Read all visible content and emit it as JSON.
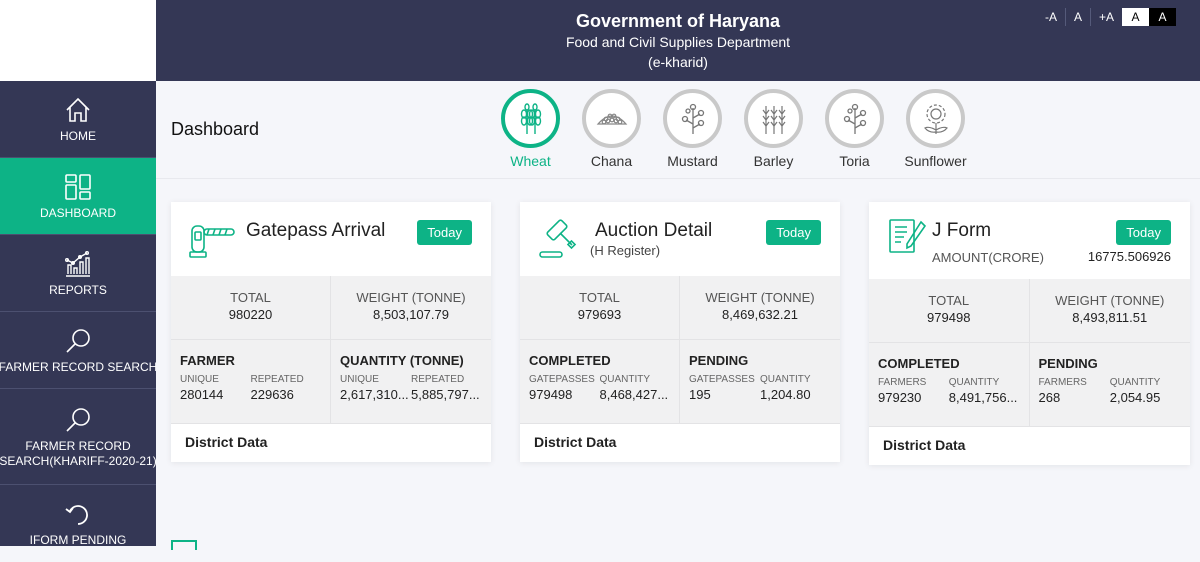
{
  "header": {
    "title": "Government of Haryana",
    "subtitle": "Food and Civil Supplies Department",
    "app": "(e-kharid)"
  },
  "font_controls": [
    "-A",
    "A",
    "+A",
    "A",
    "A"
  ],
  "sidebar": {
    "items": [
      {
        "label": "HOME",
        "icon": "home-icon"
      },
      {
        "label": "DASHBOARD",
        "icon": "dashboard-icon",
        "active": true
      },
      {
        "label": "REPORTS",
        "icon": "reports-icon"
      },
      {
        "label": "FARMER RECORD SEARCH",
        "icon": "search-icon"
      },
      {
        "label1": "FARMER RECORD",
        "label2": "SEARCH(KHARIFF-2020-21)",
        "icon": "search-icon"
      },
      {
        "label": "IFORM PENDING",
        "icon": "refresh-icon"
      }
    ]
  },
  "page_title": "Dashboard",
  "crops": [
    {
      "name": "Wheat",
      "active": true
    },
    {
      "name": "Chana"
    },
    {
      "name": "Mustard"
    },
    {
      "name": "Barley"
    },
    {
      "name": "Toria"
    },
    {
      "name": "Sunflower"
    }
  ],
  "colors": {
    "accent": "#0db386",
    "navy": "#343755"
  },
  "cards": {
    "gatepass": {
      "title": "Gatepass Arrival",
      "today": "Today",
      "total_label": "TOTAL",
      "total": "980220",
      "weight_label": "WEIGHT (TONNE)",
      "weight": "8,503,107.79",
      "left": {
        "heading": "FARMER",
        "k1": "UNIQUE",
        "v1": "280144",
        "k2": "REPEATED",
        "v2": "229636"
      },
      "right": {
        "heading": "QUANTITY (TONNE)",
        "k1": "UNIQUE",
        "v1": "2,617,310...",
        "k2": "REPEATED",
        "v2": "5,885,797..."
      },
      "district": "District Data"
    },
    "auction": {
      "title": "Auction Detail",
      "subtitle": "(H Register)",
      "today": "Today",
      "total_label": "TOTAL",
      "total": "979693",
      "weight_label": "WEIGHT (TONNE)",
      "weight": "8,469,632.21",
      "left": {
        "heading": "COMPLETED",
        "k1": "GATEPASSES",
        "v1": "979498",
        "k2": "QUANTITY",
        "v2": "8,468,427..."
      },
      "right": {
        "heading": "PENDING",
        "k1": "GATEPASSES",
        "v1": "195",
        "k2": "QUANTITY",
        "v2": "1,204.80"
      },
      "district": "District Data"
    },
    "jform": {
      "title": "J Form",
      "subtitle": "AMOUNT(CRORE)",
      "amount": "16775.506926",
      "today": "Today",
      "total_label": "TOTAL",
      "total": "979498",
      "weight_label": "WEIGHT (TONNE)",
      "weight": "8,493,811.51",
      "left": {
        "heading": "COMPLETED",
        "k1": "FARMERS",
        "v1": "979230",
        "k2": "QUANTITY",
        "v2": "8,491,756..."
      },
      "right": {
        "heading": "PENDING",
        "k1": "FARMERS",
        "v1": "268",
        "k2": "QUANTITY",
        "v2": "2,054.95"
      },
      "district": "District Data"
    }
  }
}
